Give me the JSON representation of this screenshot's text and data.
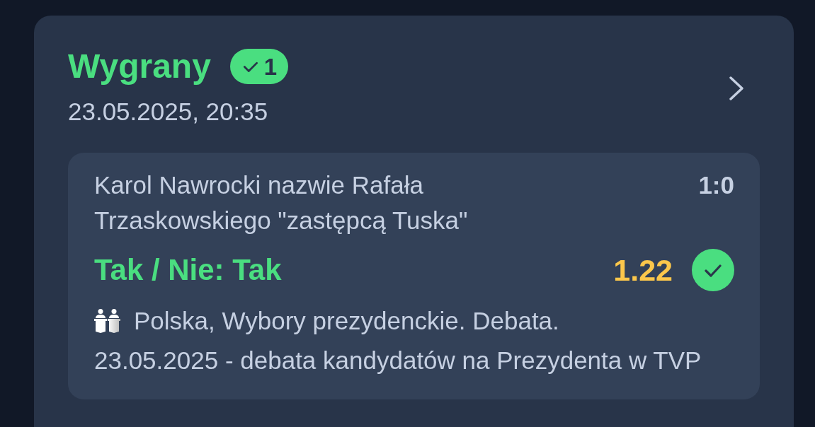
{
  "bet": {
    "status": "Wygrany",
    "won": true,
    "badge": {
      "count": "1"
    },
    "timestamp": "23.05.2025, 20:35",
    "selections": [
      {
        "event": "Karol Nawrocki nazwie Rafała Trzaskowskiego \"zastępcą Tuska\"",
        "score": "1:0",
        "pick": "Tak / Nie: Tak",
        "odds": "1.22",
        "won": true,
        "league": "Polska, Wybory prezydenckie. Debata.",
        "match": "23.05.2025 - debata kandydatów na Prezydenta w TVP"
      }
    ]
  }
}
